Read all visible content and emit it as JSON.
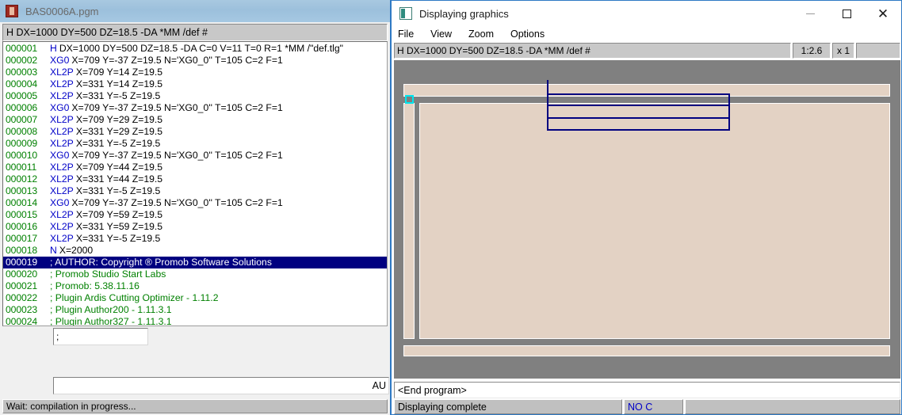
{
  "editor": {
    "title": "BAS0006A.pgm",
    "icon": "program-file-icon",
    "header_field": "H DX=1000 DY=500 DZ=18.5 -DA *MM /def #",
    "code_lines": [
      {
        "num": "000001",
        "op": "H",
        "args": "DX=1000 DY=500 DZ=18.5 -DA C=0 V=11 T=0 R=1 *MM /\"def.tlg\"",
        "selected": false,
        "comment": false
      },
      {
        "num": "000002",
        "op": "XG0",
        "args": "X=709 Y=-37 Z=19.5 N='XG0_0'' T=105 C=2 F=1",
        "selected": false,
        "comment": false
      },
      {
        "num": "000003",
        "op": "XL2P",
        "args": "X=709 Y=14 Z=19.5",
        "selected": false,
        "comment": false
      },
      {
        "num": "000004",
        "op": "XL2P",
        "args": "X=331 Y=14 Z=19.5",
        "selected": false,
        "comment": false
      },
      {
        "num": "000005",
        "op": "XL2P",
        "args": "X=331 Y=-5 Z=19.5",
        "selected": false,
        "comment": false
      },
      {
        "num": "000006",
        "op": "XG0",
        "args": "X=709 Y=-37 Z=19.5 N='XG0_0'' T=105 C=2 F=1",
        "selected": false,
        "comment": false
      },
      {
        "num": "000007",
        "op": "XL2P",
        "args": "X=709 Y=29 Z=19.5",
        "selected": false,
        "comment": false
      },
      {
        "num": "000008",
        "op": "XL2P",
        "args": "X=331 Y=29 Z=19.5",
        "selected": false,
        "comment": false
      },
      {
        "num": "000009",
        "op": "XL2P",
        "args": "X=331 Y=-5 Z=19.5",
        "selected": false,
        "comment": false
      },
      {
        "num": "000010",
        "op": "XG0",
        "args": "X=709 Y=-37 Z=19.5 N='XG0_0'' T=105 C=2 F=1",
        "selected": false,
        "comment": false
      },
      {
        "num": "000011",
        "op": "XL2P",
        "args": "X=709 Y=44 Z=19.5",
        "selected": false,
        "comment": false
      },
      {
        "num": "000012",
        "op": "XL2P",
        "args": "X=331 Y=44 Z=19.5",
        "selected": false,
        "comment": false
      },
      {
        "num": "000013",
        "op": "XL2P",
        "args": "X=331 Y=-5 Z=19.5",
        "selected": false,
        "comment": false
      },
      {
        "num": "000014",
        "op": "XG0",
        "args": "X=709 Y=-37 Z=19.5 N='XG0_0'' T=105 C=2 F=1",
        "selected": false,
        "comment": false
      },
      {
        "num": "000015",
        "op": "XL2P",
        "args": "X=709 Y=59 Z=19.5",
        "selected": false,
        "comment": false
      },
      {
        "num": "000016",
        "op": "XL2P",
        "args": "X=331 Y=59 Z=19.5",
        "selected": false,
        "comment": false
      },
      {
        "num": "000017",
        "op": "XL2P",
        "args": "X=331 Y=-5 Z=19.5",
        "selected": false,
        "comment": false
      },
      {
        "num": "000018",
        "op": "N",
        "args": "X=2000",
        "selected": false,
        "comment": false
      },
      {
        "num": "000019",
        "op": "",
        "args": "; AUTHOR: Copyright ® Promob Software Solutions",
        "selected": true,
        "comment": true
      },
      {
        "num": "000020",
        "op": "",
        "args": "; Promob Studio Start Labs",
        "selected": false,
        "comment": true
      },
      {
        "num": "000021",
        "op": "",
        "args": "; Promob: 5.38.11.16",
        "selected": false,
        "comment": true
      },
      {
        "num": "000022",
        "op": "",
        "args": "; Plugin Ardis Cutting Optimizer - 1.11.2",
        "selected": false,
        "comment": true
      },
      {
        "num": "000023",
        "op": "",
        "args": "; Plugin Author200 - 1.11.3.1",
        "selected": false,
        "comment": true
      },
      {
        "num": "000024",
        "op": "",
        "args": "; Plugin Author327 - 1.11.3.1",
        "selected": false,
        "comment": true
      }
    ],
    "small_input_value": ";",
    "wide_input_value": "AU",
    "status": "Wait: compilation in progress..."
  },
  "graphics": {
    "title": "Displaying graphics",
    "icon": "graphics-window-icon",
    "window_controls": {
      "minimize": "minimize-icon",
      "maximize": "maximize-icon",
      "close": "close-icon"
    },
    "menu": [
      {
        "label": "File"
      },
      {
        "label": "View"
      },
      {
        "label": "Zoom"
      },
      {
        "label": "Options"
      }
    ],
    "toolbar": {
      "program_header": "H DX=1000 DY=500 DZ=18.5 -DA *MM /def #",
      "scale": "1:2.6",
      "zoom": "x 1"
    },
    "canvas": {
      "background_color": "#808080",
      "panel_color": "#e3d2c4",
      "line_color": "#000080",
      "origin_marker_color": "#00e5ee",
      "origin_marker": "origin-marker"
    },
    "end_program_text": "<End program>",
    "status": {
      "message": "Displaying complete",
      "mode": "NO C"
    }
  }
}
